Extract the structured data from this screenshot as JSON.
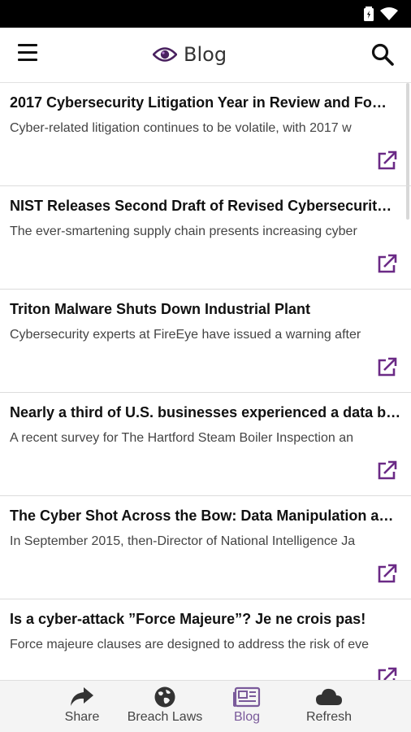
{
  "app_bar": {
    "title": "Blog"
  },
  "colors": {
    "accent": "#6b2a86",
    "text": "#111111",
    "muted": "#444444",
    "active_tab": "#7a5a9a"
  },
  "feed": {
    "items": [
      {
        "title": "2017 Cybersecurity Litigation Year in Review and Fo…",
        "summary": "Cyber-related litigation continues to be volatile, with 2017 w"
      },
      {
        "title": "NIST Releases Second Draft of Revised Cybersecurit…",
        "summary": "The ever-smartening supply chain presents increasing cyber"
      },
      {
        "title": "Triton Malware Shuts Down Industrial Plant",
        "summary": "Cybersecurity experts at FireEye have issued a warning after"
      },
      {
        "title": "Nearly a third of U.S. businesses experienced a data b…",
        "summary": "A recent survey for The Hartford Steam Boiler Inspection an"
      },
      {
        "title": "The Cyber Shot Across the Bow: Data Manipulation a…",
        "summary": "In September 2015, then-Director of National Intelligence Ja"
      },
      {
        "title": "Is a cyber-attack ”Force Majeure”? Je ne crois pas!",
        "summary": "Force majeure clauses are designed to address the risk of eve"
      }
    ]
  },
  "bottom_nav": {
    "share": "Share",
    "breach_laws": "Breach Laws",
    "blog": "Blog",
    "refresh": "Refresh"
  }
}
